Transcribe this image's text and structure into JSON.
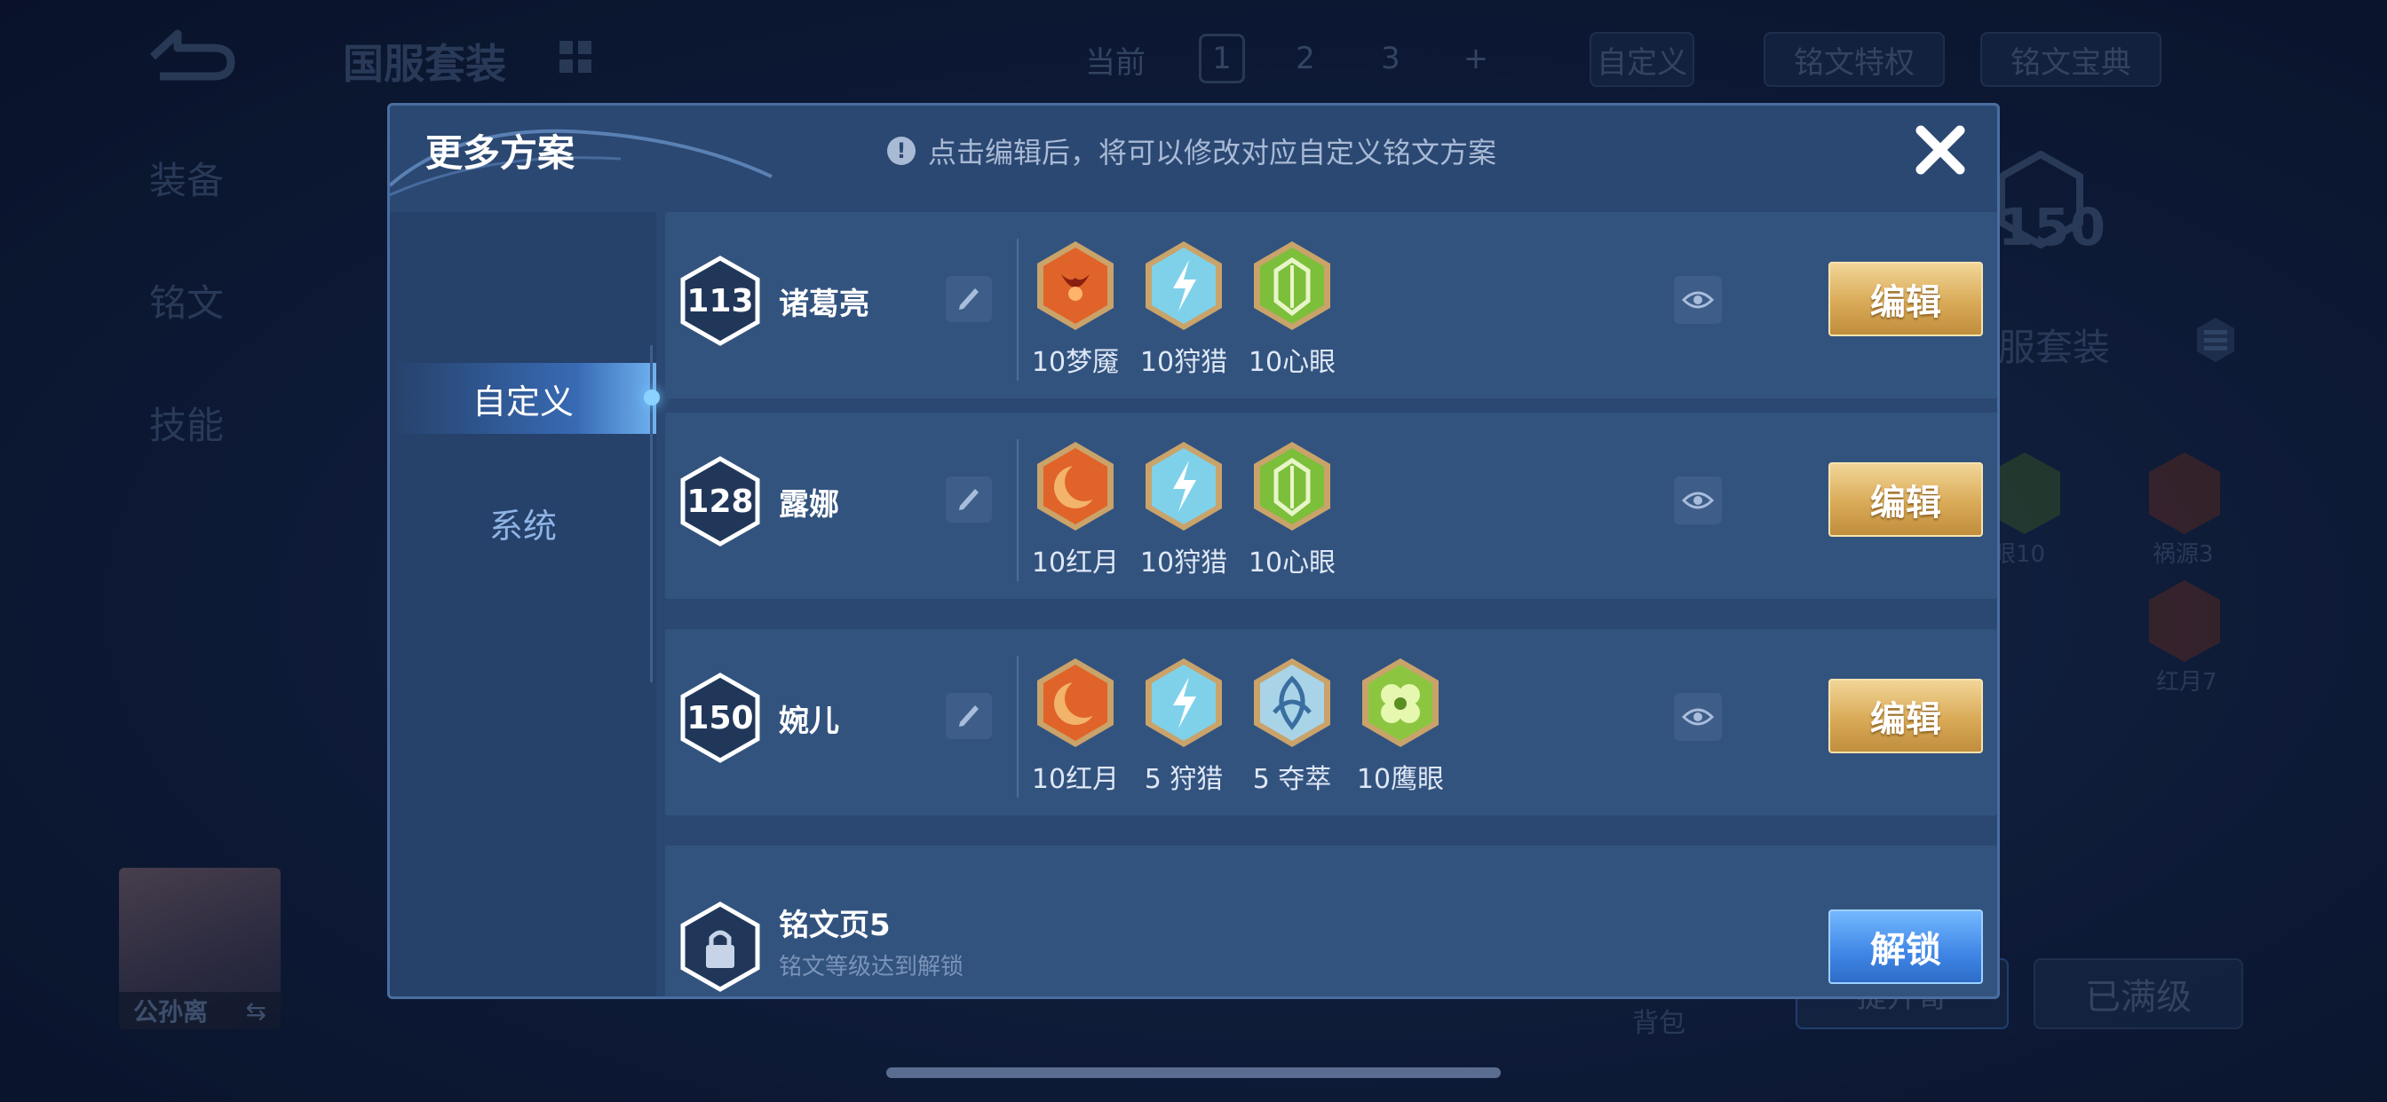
{
  "background": {
    "title": "国服套装",
    "menu": [
      "装备",
      "铭文",
      "技能"
    ],
    "tabs_prefix": "当前",
    "pages": [
      "1",
      "2",
      "3",
      "+"
    ],
    "custom_label": "自定义",
    "privilege_label": "铭文特权",
    "dictionary_label": "铭文宝典",
    "hero_name": "公孙离",
    "bag_label": "背包",
    "upgrade_label": "提升哥",
    "maxed_label": "已满级",
    "side_level": "150",
    "side_suit": "服套装",
    "side_runes": [
      "眼10",
      "祸源3",
      "红月7"
    ]
  },
  "modal": {
    "title": "更多方案",
    "notice": "点击编辑后，将可以修改对应自定义铭文方案",
    "tabs": [
      {
        "label": "自定义",
        "active": true
      },
      {
        "label": "系统",
        "active": false
      }
    ],
    "rows": [
      {
        "level": "113",
        "hero": "诸葛亮",
        "runes": [
          {
            "icon": "mengyan",
            "color": "#e0632a",
            "label": "10梦魇"
          },
          {
            "icon": "shoulie",
            "color": "#7fd1ea",
            "label": "10狩猎"
          },
          {
            "icon": "xinyan",
            "color": "#7cbf3a",
            "label": "10心眼"
          }
        ],
        "button": "编辑"
      },
      {
        "level": "128",
        "hero": "露娜",
        "runes": [
          {
            "icon": "hongyue",
            "color": "#e0632a",
            "label": "10红月"
          },
          {
            "icon": "shoulie",
            "color": "#7fd1ea",
            "label": "10狩猎"
          },
          {
            "icon": "xinyan",
            "color": "#7cbf3a",
            "label": "10心眼"
          }
        ],
        "button": "编辑"
      },
      {
        "level": "150",
        "hero": "婉儿",
        "runes": [
          {
            "icon": "hongyue",
            "color": "#e0632a",
            "label": "10红月"
          },
          {
            "icon": "shoulie",
            "color": "#7fd1ea",
            "label": "5 狩猎"
          },
          {
            "icon": "duocui",
            "color": "#a9d4e8",
            "label": "5 夺萃"
          },
          {
            "icon": "yingyan",
            "color": "#8cc641",
            "label": "10鹰眼"
          }
        ],
        "button": "编辑"
      }
    ],
    "locked": {
      "title": "铭文页5",
      "subtitle": "铭文等级达到解锁",
      "button": "解锁"
    }
  },
  "colors": {
    "modal_bg": "#2b4872",
    "row_bg": "#33537f",
    "edit_gold": "#d9aa57",
    "unlock_blue": "#3f86e6"
  }
}
